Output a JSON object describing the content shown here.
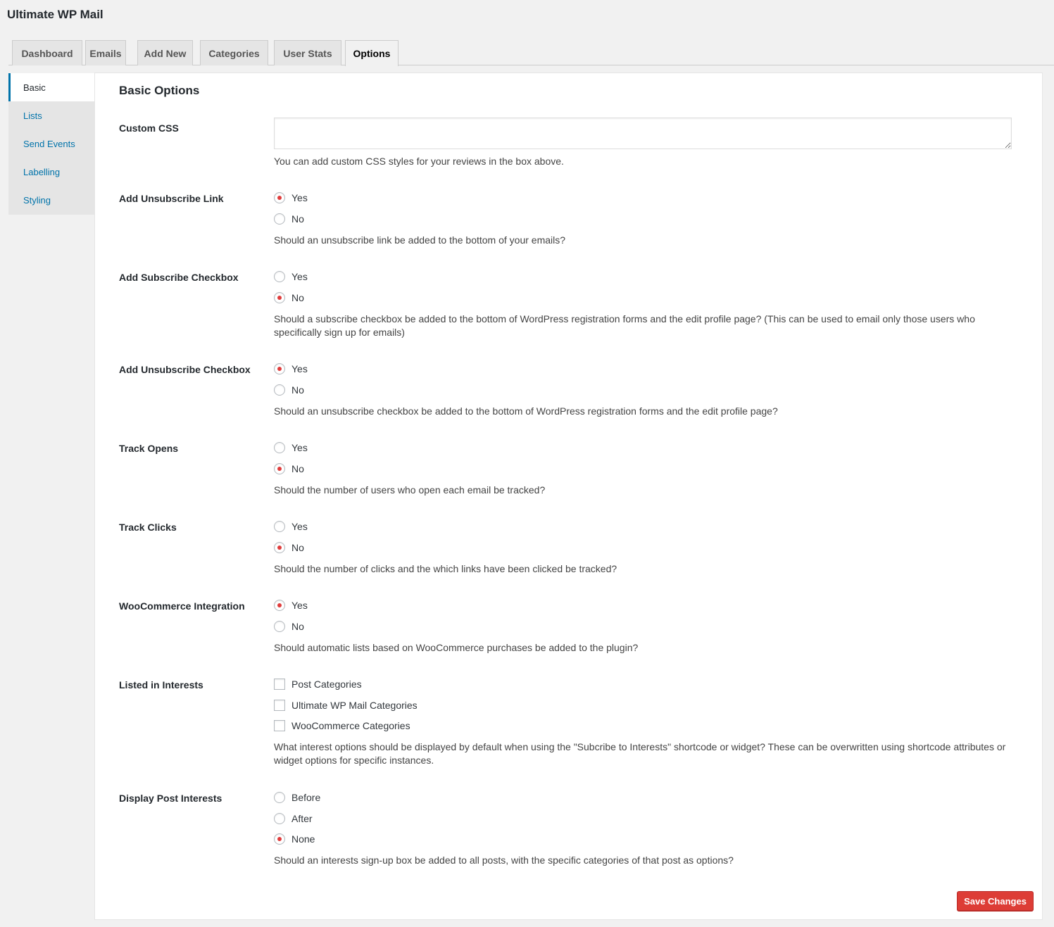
{
  "app": {
    "title": "Ultimate WP Mail"
  },
  "tabs": [
    {
      "label": "Dashboard",
      "active": false
    },
    {
      "label": "Emails",
      "active": false
    },
    {
      "label": "Add New",
      "active": false
    },
    {
      "label": "Categories",
      "active": false
    },
    {
      "label": "User Stats",
      "active": false
    },
    {
      "label": "Options",
      "active": true
    }
  ],
  "sidebar": {
    "items": [
      {
        "label": "Basic",
        "active": true
      },
      {
        "label": "Lists",
        "active": false
      },
      {
        "label": "Send Events",
        "active": false
      },
      {
        "label": "Labelling",
        "active": false
      },
      {
        "label": "Styling",
        "active": false
      }
    ]
  },
  "panel": {
    "title": "Basic Options",
    "custom_css": {
      "label": "Custom CSS",
      "value": "",
      "description": "You can add custom CSS styles for your reviews in the box above."
    },
    "unsubscribe_link": {
      "label": "Add Unsubscribe Link",
      "options": [
        "Yes",
        "No"
      ],
      "selected": "Yes",
      "description": "Should an unsubscribe link be added to the bottom of your emails?"
    },
    "subscribe_checkbox": {
      "label": "Add Subscribe Checkbox",
      "options": [
        "Yes",
        "No"
      ],
      "selected": "No",
      "description": "Should a subscribe checkbox be added to the bottom of WordPress registration forms and the edit profile page? (This can be used to email only those users who specifically sign up for emails)"
    },
    "unsubscribe_checkbox": {
      "label": "Add Unsubscribe Checkbox",
      "options": [
        "Yes",
        "No"
      ],
      "selected": "Yes",
      "description": "Should an unsubscribe checkbox be added to the bottom of WordPress registration forms and the edit profile page?"
    },
    "track_opens": {
      "label": "Track Opens",
      "options": [
        "Yes",
        "No"
      ],
      "selected": "No",
      "description": "Should the number of users who open each email be tracked?"
    },
    "track_clicks": {
      "label": "Track Clicks",
      "options": [
        "Yes",
        "No"
      ],
      "selected": "No",
      "description": "Should the number of clicks and the which links have been clicked be tracked?"
    },
    "woocommerce": {
      "label": "WooCommerce Integration",
      "options": [
        "Yes",
        "No"
      ],
      "selected": "Yes",
      "description": "Should automatic lists based on WooCommerce purchases be added to the plugin?"
    },
    "interests": {
      "label": "Listed in Interests",
      "options": [
        {
          "label": "Post Categories",
          "checked": false
        },
        {
          "label": "Ultimate WP Mail Categories",
          "checked": false
        },
        {
          "label": "WooCommerce Categories",
          "checked": false
        }
      ],
      "description": "What interest options should be displayed by default when using the \"Subcribe to Interests\" shortcode or widget? These can be overwritten using shortcode attributes or widget options for specific instances."
    },
    "post_interests": {
      "label": "Display Post Interests",
      "options": [
        "Before",
        "After",
        "None"
      ],
      "selected": "None",
      "description": "Should an interests sign-up box be added to all posts, with the specific categories of that post as options?"
    },
    "save_label": "Save Changes"
  },
  "colors": {
    "accent": "#0073aa",
    "radio_dot": "#e03c3c",
    "save_button": "#dd3d36"
  }
}
